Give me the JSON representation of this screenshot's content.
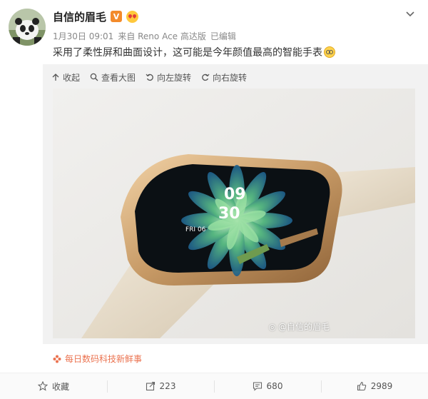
{
  "author": {
    "name": "自信的眉毛",
    "verified_badge": "V",
    "avatar_icon": "panda-avatar",
    "badge_icon": "heart-emoji-icon"
  },
  "meta": {
    "date": "1月30日 09:01",
    "source": "来自 Reno Ace 高达版",
    "edited": "已编辑"
  },
  "post_text": "采用了柔性屏和曲面设计，这可能是今年颜值最高的智能手表",
  "post_emoji": "smile-emoji-icon",
  "media_toolbar": {
    "collapse": "收起",
    "view_large": "查看大图",
    "rotate_left": "向左旋转",
    "rotate_right": "向右旋转"
  },
  "photo": {
    "watch_time_hour": "09",
    "watch_time_minute": "30",
    "watch_date": "FRI 06",
    "watermark": "@自信的眉毛"
  },
  "source_topic": "每日数码科技新鲜事",
  "actions": {
    "favorite": "收藏",
    "repost": "223",
    "comment": "680",
    "like": "2989"
  },
  "colors": {
    "accent": "#eb7350",
    "badge": "#f38b2b",
    "meta_text": "#888888"
  }
}
